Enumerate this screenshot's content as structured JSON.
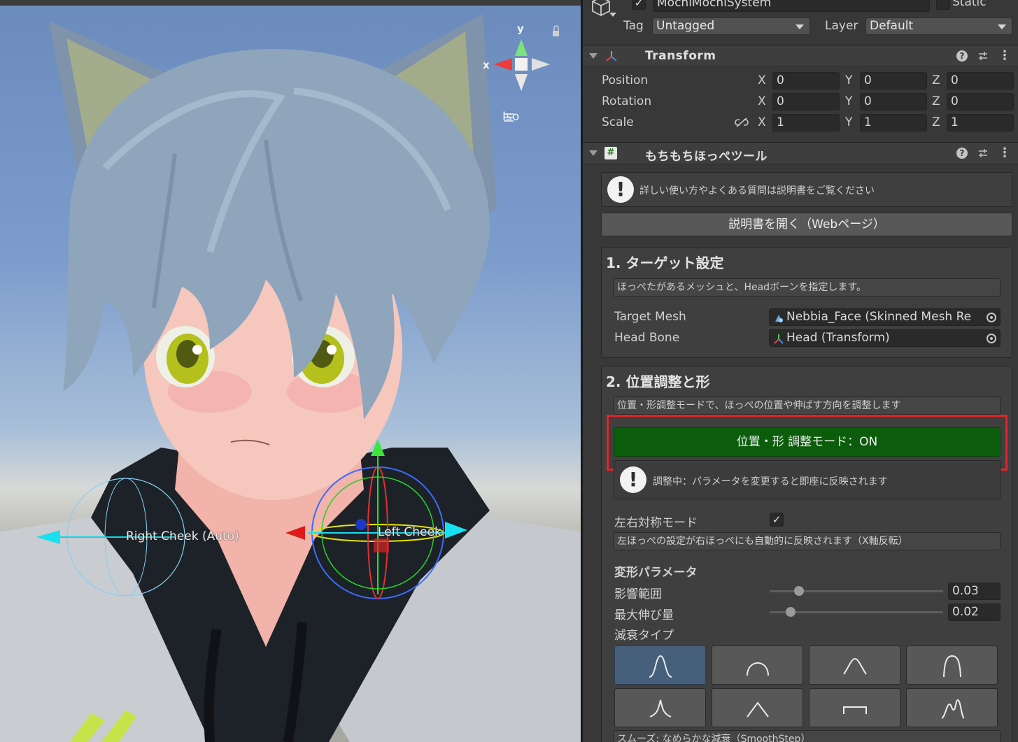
{
  "gameobject": {
    "name": "MochiMochiSystem",
    "static_label": "Static",
    "tag_label": "Tag",
    "tag_value": "Untagged",
    "layer_label": "Layer",
    "layer_value": "Default"
  },
  "transform": {
    "title": "Transform",
    "rows": [
      {
        "label": "Position",
        "x": "0",
        "y": "0",
        "z": "0"
      },
      {
        "label": "Rotation",
        "x": "0",
        "y": "0",
        "z": "0"
      },
      {
        "label": "Scale",
        "x": "1",
        "y": "1",
        "z": "1"
      }
    ],
    "axis_x": "X",
    "axis_y": "Y",
    "axis_z": "Z"
  },
  "tool": {
    "title": "もちもちほっぺツール",
    "help_message": "詳しい使い方やよくある質問は説明書をご覧ください",
    "open_manual_button": "説明書を開く（Webページ）",
    "section1": {
      "title": "1. ターゲット設定",
      "help": "ほっぺたがあるメッシュと、Headボーンを指定します。",
      "target_mesh_label": "Target Mesh",
      "target_mesh_value": "Nebbia_Face (Skinned Mesh Re",
      "head_bone_label": "Head Bone",
      "head_bone_value": "Head (Transform)"
    },
    "section2": {
      "title": "2. 位置調整と形",
      "help": "位置・形調整モードで、ほっぺの位置や伸ばす方向を調整します",
      "mode_button": "位置・形 調整モード：ON",
      "adjust_warning": "調整中：パラメータを変更すると即座に反映されます",
      "symmetry_label": "左右対称モード",
      "symmetry_checked": "✓",
      "symmetry_help": "左ほっぺの設定が右ほっぺにも自動的に反映されます（X軸反転）",
      "deform_title": "変形パラメータ",
      "influence_label": "影響範囲",
      "influence_value": "0.03",
      "influence_fraction": 0.17,
      "stretch_label": "最大伸び量",
      "stretch_value": "0.02",
      "stretch_fraction": 0.12,
      "falloff_label": "減衰タイプ",
      "falloff_note": "スムーズ: なめらかな減衰（SmoothStep）"
    }
  },
  "scene": {
    "gizmo_y": "y",
    "gizmo_x": "x",
    "projection": "Iso",
    "right_cheek_label": "Right Cheek (Auto)",
    "left_cheek_label": "Left Cheek"
  },
  "colors": {
    "mode_on_green": "#0b5d0b",
    "highlight_red": "#e0242a",
    "selected_shape": "#46607c"
  }
}
